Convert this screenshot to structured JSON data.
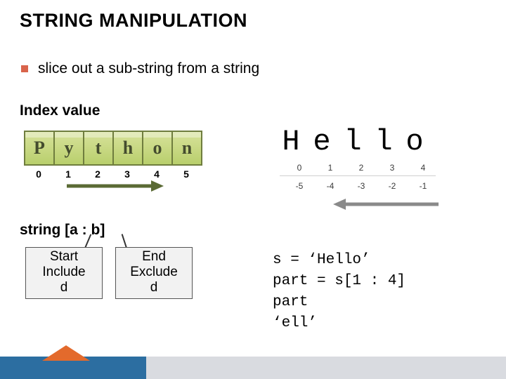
{
  "title": "STRING MANIPULATION",
  "bullet": "slice out a sub-string from a string",
  "index_label": "Index value",
  "python_letters": [
    "P",
    "y",
    "t",
    "h",
    "o",
    "n"
  ],
  "python_idx": [
    "0",
    "1",
    "2",
    "3",
    "4",
    "5"
  ],
  "hello_letters": [
    "H",
    "e",
    "l",
    "l",
    "o"
  ],
  "hello_pos": [
    "0",
    "1",
    "2",
    "3",
    "4"
  ],
  "hello_neg": [
    "-5",
    "-4",
    "-3",
    "-2",
    "-1"
  ],
  "syntax": "string [a : b]",
  "pop1": {
    "l1": "Start",
    "l2": "Include",
    "l3": "d"
  },
  "pop2": {
    "l1": "End",
    "l2": "Exclude",
    "l3": "d"
  },
  "code": {
    "l1": "s = ‘Hello’",
    "l2": "part = s[1 : 4]",
    "l3": "part",
    "l4": "‘ell’"
  }
}
